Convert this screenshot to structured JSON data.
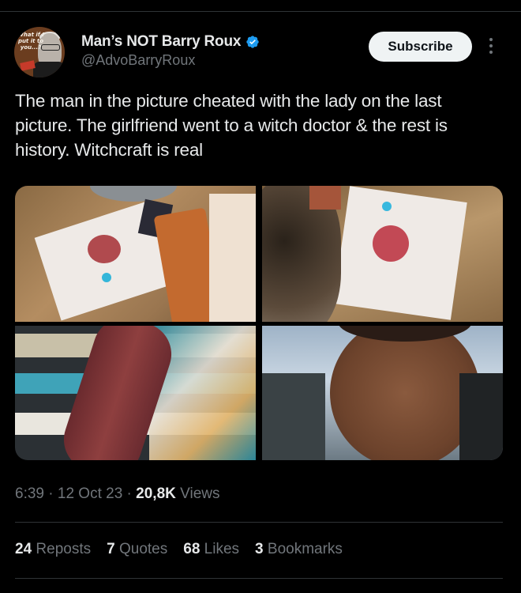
{
  "author": {
    "display_name": "Man’s NOT Barry Roux",
    "handle": "@AdvoBarryRoux",
    "verified": true,
    "avatar_text": "What if I put it to you...? It's not Barry",
    "verified_color": "#1d9bf0"
  },
  "actions": {
    "subscribe_label": "Subscribe",
    "more_icon": "more-vertical-icon"
  },
  "tweet": {
    "text": "The man in the picture cheated with the lady on the last picture. The girlfriend went to a witch doctor & the rest is history. Witchcraft is real"
  },
  "media": {
    "count": 4
  },
  "meta": {
    "time": "6:39",
    "date": "12 Oct 23",
    "views_count": "20,8K",
    "views_label": "Views",
    "sep": " · "
  },
  "stats": [
    {
      "count": "24",
      "label": "Reposts"
    },
    {
      "count": "7",
      "label": "Quotes"
    },
    {
      "count": "68",
      "label": "Likes"
    },
    {
      "count": "3",
      "label": "Bookmarks"
    }
  ],
  "colors": {
    "background": "#000000",
    "text": "#e7e9ea",
    "secondary": "#71767b",
    "divider": "#2f3336",
    "button_bg": "#eff3f4"
  }
}
